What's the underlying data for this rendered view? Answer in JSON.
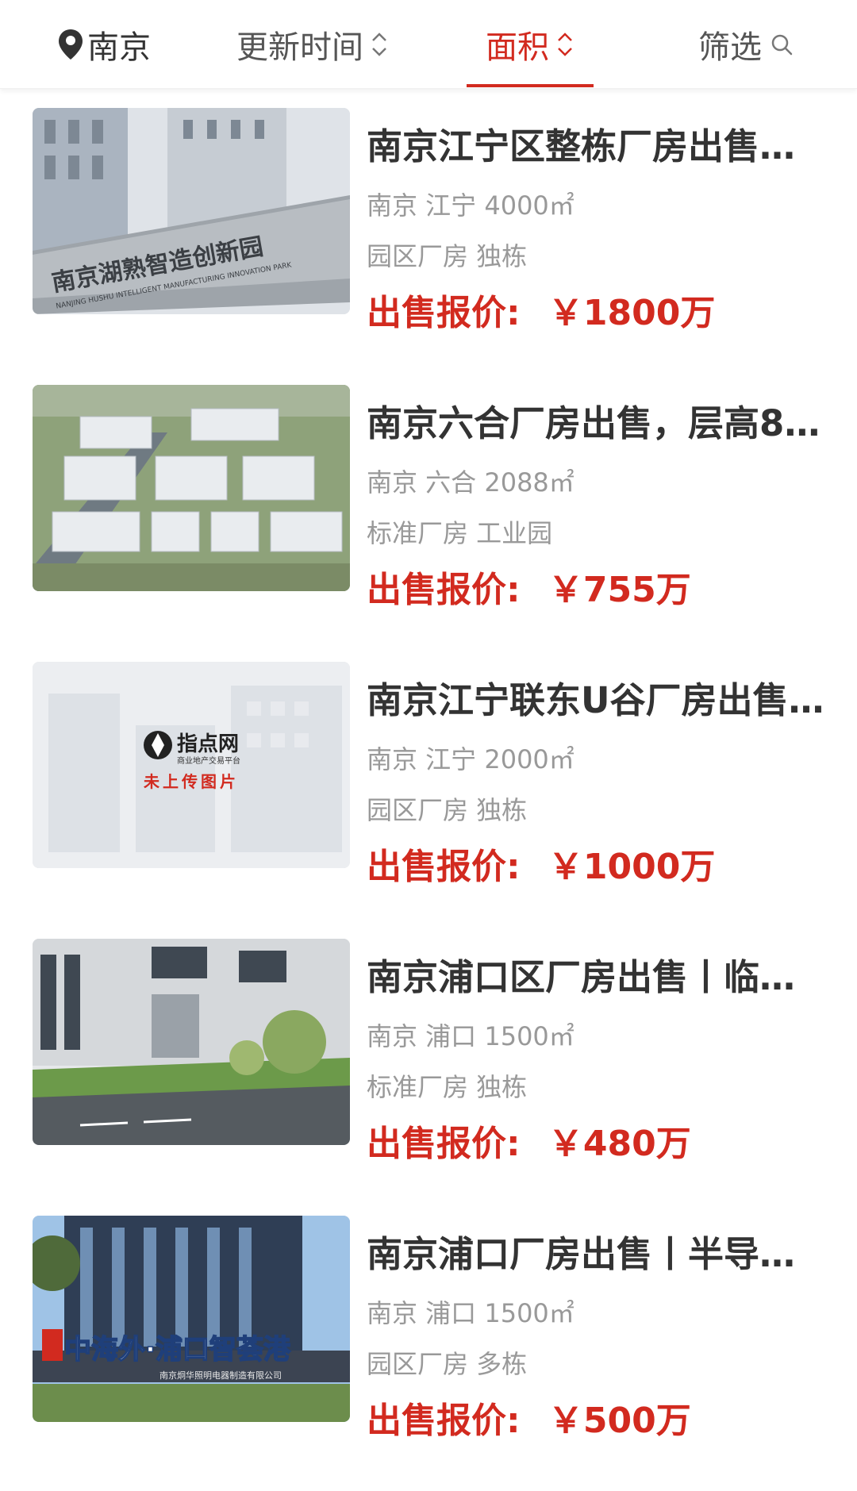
{
  "filters": {
    "city": "南京",
    "update_time": "更新时间",
    "area": "面积",
    "filter": "筛选"
  },
  "colors": {
    "accent": "#d22a1f",
    "text": "#333333",
    "muted": "#999999"
  },
  "listings": [
    {
      "title": "南京江宁区整栋厂房出售…",
      "location": "南京 江宁 4000㎡",
      "tags": "园区厂房 独栋",
      "price_label": "出售报价:",
      "price": "￥1800万",
      "sign_text": "南京湖熟智造创新园",
      "sign_subtext": "NANJING HUSHU INTELLIGENT MANUFACTURING INNOVATION PARK"
    },
    {
      "title": "南京六合厂房出售，层高8.…",
      "location": "南京 六合 2088㎡",
      "tags": "标准厂房 工业园",
      "price_label": "出售报价:",
      "price": "￥755万"
    },
    {
      "title": "南京江宁联东U谷厂房出售…",
      "location": "南京 江宁 2000㎡",
      "tags": "园区厂房 独栋",
      "price_label": "出售报价:",
      "price": "￥1000万",
      "placeholder_brand": "指点网",
      "placeholder_slogan": "商业地产交易平台",
      "placeholder_text": "未上传图片"
    },
    {
      "title": "南京浦口区厂房出售丨临…",
      "location": "南京 浦口 1500㎡",
      "tags": "标准厂房 独栋",
      "price_label": "出售报价:",
      "price": "￥480万"
    },
    {
      "title": "南京浦口厂房出售丨半导…",
      "location": "南京 浦口 1500㎡",
      "tags": "园区厂房 多栋",
      "price_label": "出售报价:",
      "price": "￥500万",
      "sign_text": "中海外·浦口智荟港",
      "sign_subtext": "南京炯华照明电器制造有限公司"
    }
  ]
}
